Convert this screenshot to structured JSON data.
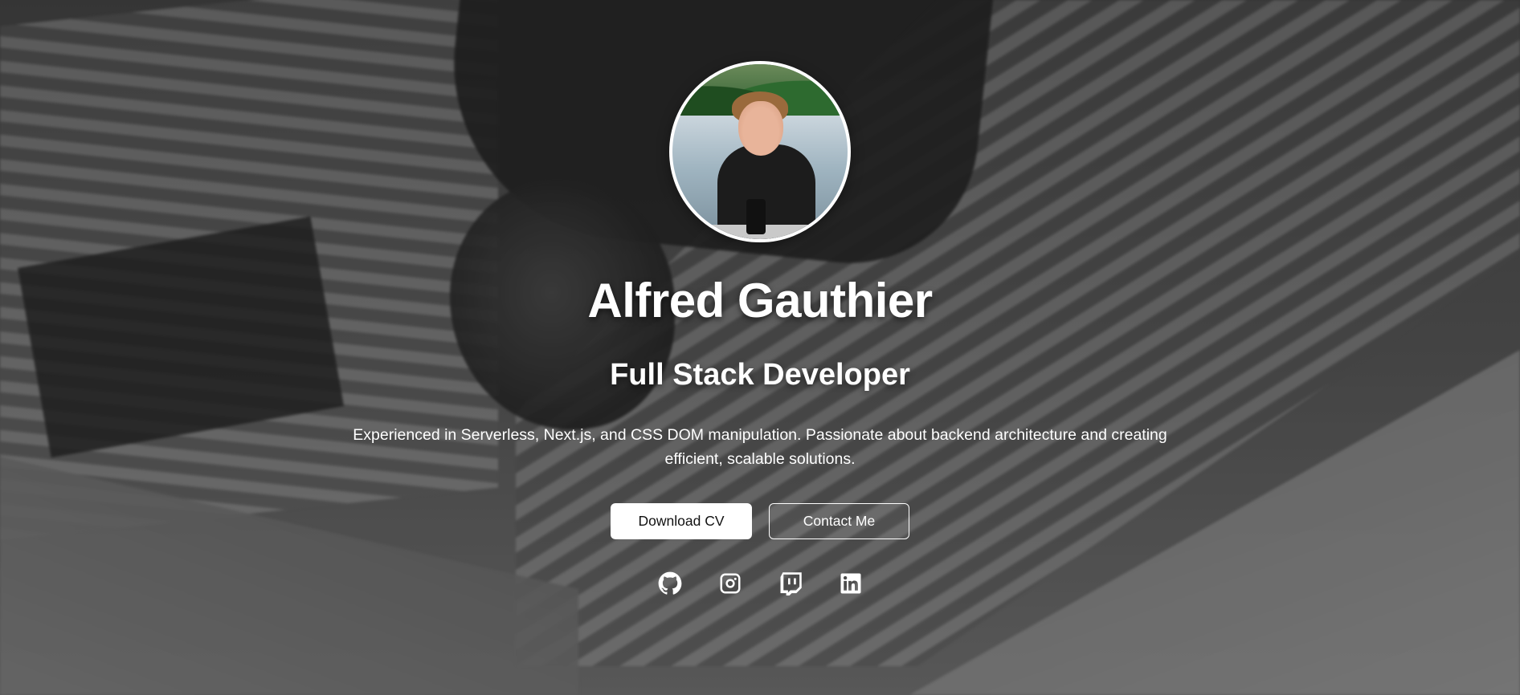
{
  "hero": {
    "name": "Alfred Gauthier",
    "title": "Full Stack Developer",
    "description": "Experienced in Serverless, Next.js, and CSS DOM manipulation. Passionate about backend architecture and creating efficient, scalable solutions."
  },
  "buttons": {
    "download_cv": "Download CV",
    "contact": "Contact Me"
  },
  "socials": [
    {
      "icon": "github-icon"
    },
    {
      "icon": "instagram-icon"
    },
    {
      "icon": "twitch-icon"
    },
    {
      "icon": "linkedin-icon"
    }
  ],
  "colors": {
    "text": "#ffffff",
    "primary_button_bg": "#ffffff",
    "primary_button_text": "#111111"
  }
}
